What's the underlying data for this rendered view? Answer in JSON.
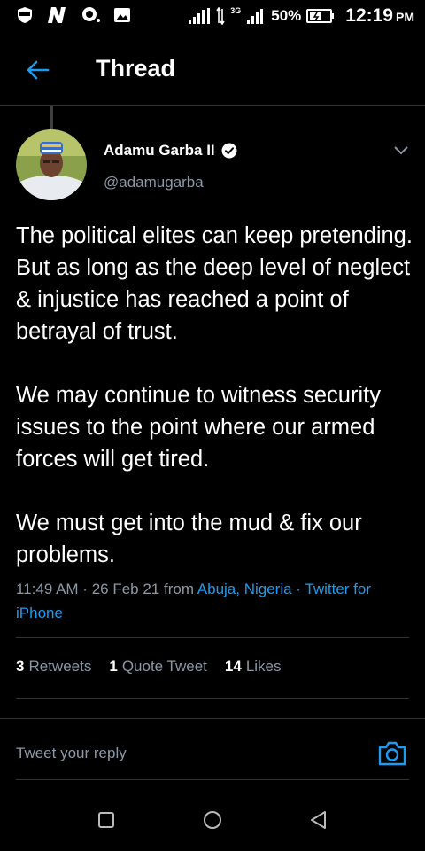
{
  "status_bar": {
    "network": "3G",
    "battery": "50%",
    "time": "12:19",
    "ampm": "PM"
  },
  "header": {
    "title": "Thread"
  },
  "tweet": {
    "author_name": "Adamu Garba II",
    "verified": true,
    "handle": "@adamugarba",
    "paragraphs": [
      "The political elites can keep pretending. But as long as the deep level of neglect & injustice has reached a point of betrayal of trust.",
      "We may continue to witness security issues to the point where our armed forces will get tired.",
      "We must get into the mud & fix our problems."
    ],
    "time": "11:49 AM",
    "date": "26 Feb 21",
    "from_label": "from",
    "location": "Abuja, Nigeria",
    "source": "Twitter for iPhone",
    "separator": " · "
  },
  "stats": {
    "retweets_count": "3",
    "retweets_label": "Retweets",
    "quotes_count": "1",
    "quotes_label": "Quote Tweet",
    "likes_count": "14",
    "likes_label": "Likes"
  },
  "reply": {
    "placeholder": "Tweet your reply"
  },
  "colors": {
    "accent": "#1d9bf0",
    "muted": "#8b98a5",
    "divider": "#2f3336",
    "background": "#000000"
  },
  "icons": [
    "shield-icon",
    "n-app-icon",
    "chat-app-icon",
    "image-icon",
    "signal-icon",
    "battery-icon",
    "back-arrow-icon",
    "verified-badge-icon",
    "chevron-down-icon",
    "camera-icon",
    "square-nav-icon",
    "circle-nav-icon",
    "triangle-back-nav-icon"
  ]
}
